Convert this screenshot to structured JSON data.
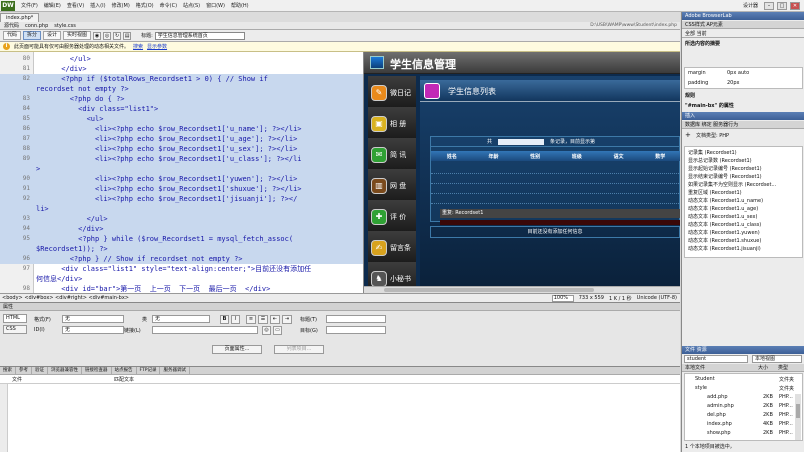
{
  "app": {
    "logo": "DW",
    "menus": [
      "文件(F)",
      "编辑(E)",
      "查看(V)",
      "插入(I)",
      "修改(M)",
      "格式(O)",
      "命令(C)",
      "站点(S)",
      "窗口(W)",
      "帮助(H)"
    ],
    "right_label": "设计器",
    "window_buttons": [
      "–",
      "□",
      "✕"
    ]
  },
  "document": {
    "tab": "index.php*",
    "path_files": [
      "源代码",
      "conn.php",
      "style.css"
    ],
    "path_right": "D:\\USB\\WAMP\\www\\Student\\index.php",
    "view_buttons": [
      "代码",
      "拆分",
      "设计",
      "实时视图"
    ],
    "active_view": 1,
    "title_label": "标题:",
    "title_value": "学生信息管理系统首页",
    "info_text": "此页面可能具有仅可由服务器处理的动态相关文件。",
    "info_links": [
      "搜索",
      "显示参数"
    ],
    "code_lines": [
      {
        "n": "80",
        "t": "        </ul>",
        "sel": false
      },
      {
        "n": "81",
        "t": "      </div>",
        "sel": false
      },
      {
        "n": "82",
        "t": "      <?php if ($totalRows_Recordset1 > 0) { // Show if",
        "sel": true
      },
      {
        "n": "",
        "t": "recordset not empty ?>",
        "sel": true
      },
      {
        "n": "83",
        "t": "        <?php do { ?>",
        "sel": true
      },
      {
        "n": "84",
        "t": "          <div class=\"list1\">",
        "sel": true
      },
      {
        "n": "85",
        "t": "            <ul>",
        "sel": true
      },
      {
        "n": "86",
        "t": "              <li><?php echo $row_Recordset1['u_name']; ?></li>",
        "sel": true
      },
      {
        "n": "87",
        "t": "              <li><?php echo $row_Recordset1['u_age']; ?></li>",
        "sel": true
      },
      {
        "n": "88",
        "t": "              <li><?php echo $row_Recordset1['u_sex']; ?></li>",
        "sel": true
      },
      {
        "n": "89",
        "t": "              <li><?php echo $row_Recordset1['u_class']; ?></li",
        "sel": true
      },
      {
        "n": "",
        "t": ">",
        "sel": true
      },
      {
        "n": "90",
        "t": "              <li><?php echo $row_Recordset1['yuwen']; ?></li>",
        "sel": true
      },
      {
        "n": "91",
        "t": "              <li><?php echo $row_Recordset1['shuxue']; ?></li>",
        "sel": true
      },
      {
        "n": "92",
        "t": "              <li><?php echo $row_Recordset1['jisuanji']; ?></",
        "sel": true
      },
      {
        "n": "",
        "t": "li>",
        "sel": true
      },
      {
        "n": "93",
        "t": "            </ul>",
        "sel": true
      },
      {
        "n": "94",
        "t": "          </div>",
        "sel": true
      },
      {
        "n": "95",
        "t": "          <?php } while ($row_Recordset1 = mysql_fetch_assoc(",
        "sel": true
      },
      {
        "n": "",
        "t": "$Recordset1)); ?>",
        "sel": true
      },
      {
        "n": "96",
        "t": "        <?php } // Show if recordset not empty ?>",
        "sel": true
      },
      {
        "n": "97",
        "t": "      <div class=\"list1\" style=\"text-align:center;\">目前还没有添加任",
        "sel": false
      },
      {
        "n": "",
        "t": "何信息</div>",
        "sel": false
      },
      {
        "n": "98",
        "t": "      <div id=\"bar\">第一页  上一页  下一页  最后一页  </div>",
        "sel": false
      }
    ],
    "status_path": "<body> <div#box> <div#right> <div#main-bx>",
    "status_right": [
      "100%",
      "733 x 559",
      "1 K / 1 秒",
      "Unicode (UTF-8)"
    ]
  },
  "design": {
    "site_title": "学生信息管理",
    "sidebar": [
      "微日记",
      "相 册",
      "简 讯",
      "网 盘",
      "评 价",
      "留言条",
      "小秘书"
    ],
    "list_title": "学生信息列表",
    "search_label": "共",
    "search_suffix": "条记录，目前显示第",
    "headers": [
      "姓名",
      "年龄",
      "性别",
      "班级",
      "语文",
      "数学"
    ],
    "repeat_label": "重复: Recordset1",
    "no_data": "目前还没有添加任何信息"
  },
  "properties": {
    "title": "属性",
    "tabs": [
      "HTML",
      "CSS"
    ],
    "format_label": "格式(F)",
    "format_value": "无",
    "id_label": "ID(I)",
    "id_value": "无",
    "class_label": "类",
    "class_value": "无",
    "link_label": "链接(L)",
    "title_label": "标题(T)",
    "target_label": "目标(G)",
    "page_props": "页面属性...",
    "list_item": "列表项目..."
  },
  "results": {
    "tabs": [
      "搜索",
      "参考",
      "验证",
      "浏览器兼容性",
      "链接检查器",
      "站点报告",
      "FTP记录",
      "服务器调试"
    ],
    "columns": [
      "文件",
      "匹配文本"
    ]
  },
  "right": {
    "browserlab": "Adobe BrowserLab",
    "css_tabs": "CSS样式  AP元素",
    "css_mode": "全部  当前",
    "summary_title": "所选内容的摘要",
    "props": [
      [
        "margin",
        "0px auto"
      ],
      [
        "padding",
        "20px"
      ]
    ],
    "rules_title": "规则",
    "props_title": "\"#main-bx\" 的属性",
    "insert_tab": "插入",
    "data_tabs": "数据库  绑定  服务器行为",
    "doc_type": "文档类型: PHP",
    "behaviors": [
      "记录集 (Recordset1)",
      "显示总记录数 (Recordset1)",
      "显示起始记录编号 (Recordset1)",
      "显示结束记录编号 (Recordset1)",
      "如果记录集不为空则显示 (Recordset...",
      "重复区域 (Recordset1)",
      "动态文本 (Recordset1.u_name)",
      "动态文本 (Recordset1.u_age)",
      "动态文本 (Recordset1.u_sex)",
      "动态文本 (Recordset1.u_class)",
      "动态文本 (Recordset1.yuwen)",
      "动态文本 (Recordset1.shuxue)",
      "动态文本 (Recordset1.jisuanji)"
    ],
    "files_tab": "文件  资源",
    "site": "student",
    "view": "本地视图",
    "file_cols": [
      "本地文件",
      "大小",
      "类型"
    ],
    "files": [
      [
        "Student",
        "",
        "文件夹"
      ],
      [
        "style",
        "",
        "文件夹"
      ],
      [
        "add.php",
        "2KB",
        "PHP..."
      ],
      [
        "admin.php",
        "2KB",
        "PHP..."
      ],
      [
        "del.php",
        "2KB",
        "PHP..."
      ],
      [
        "index.php",
        "4KB",
        "PHP..."
      ],
      [
        "show.php",
        "2KB",
        "PHP..."
      ]
    ],
    "files_status": "1 个本地项目被选中，"
  }
}
